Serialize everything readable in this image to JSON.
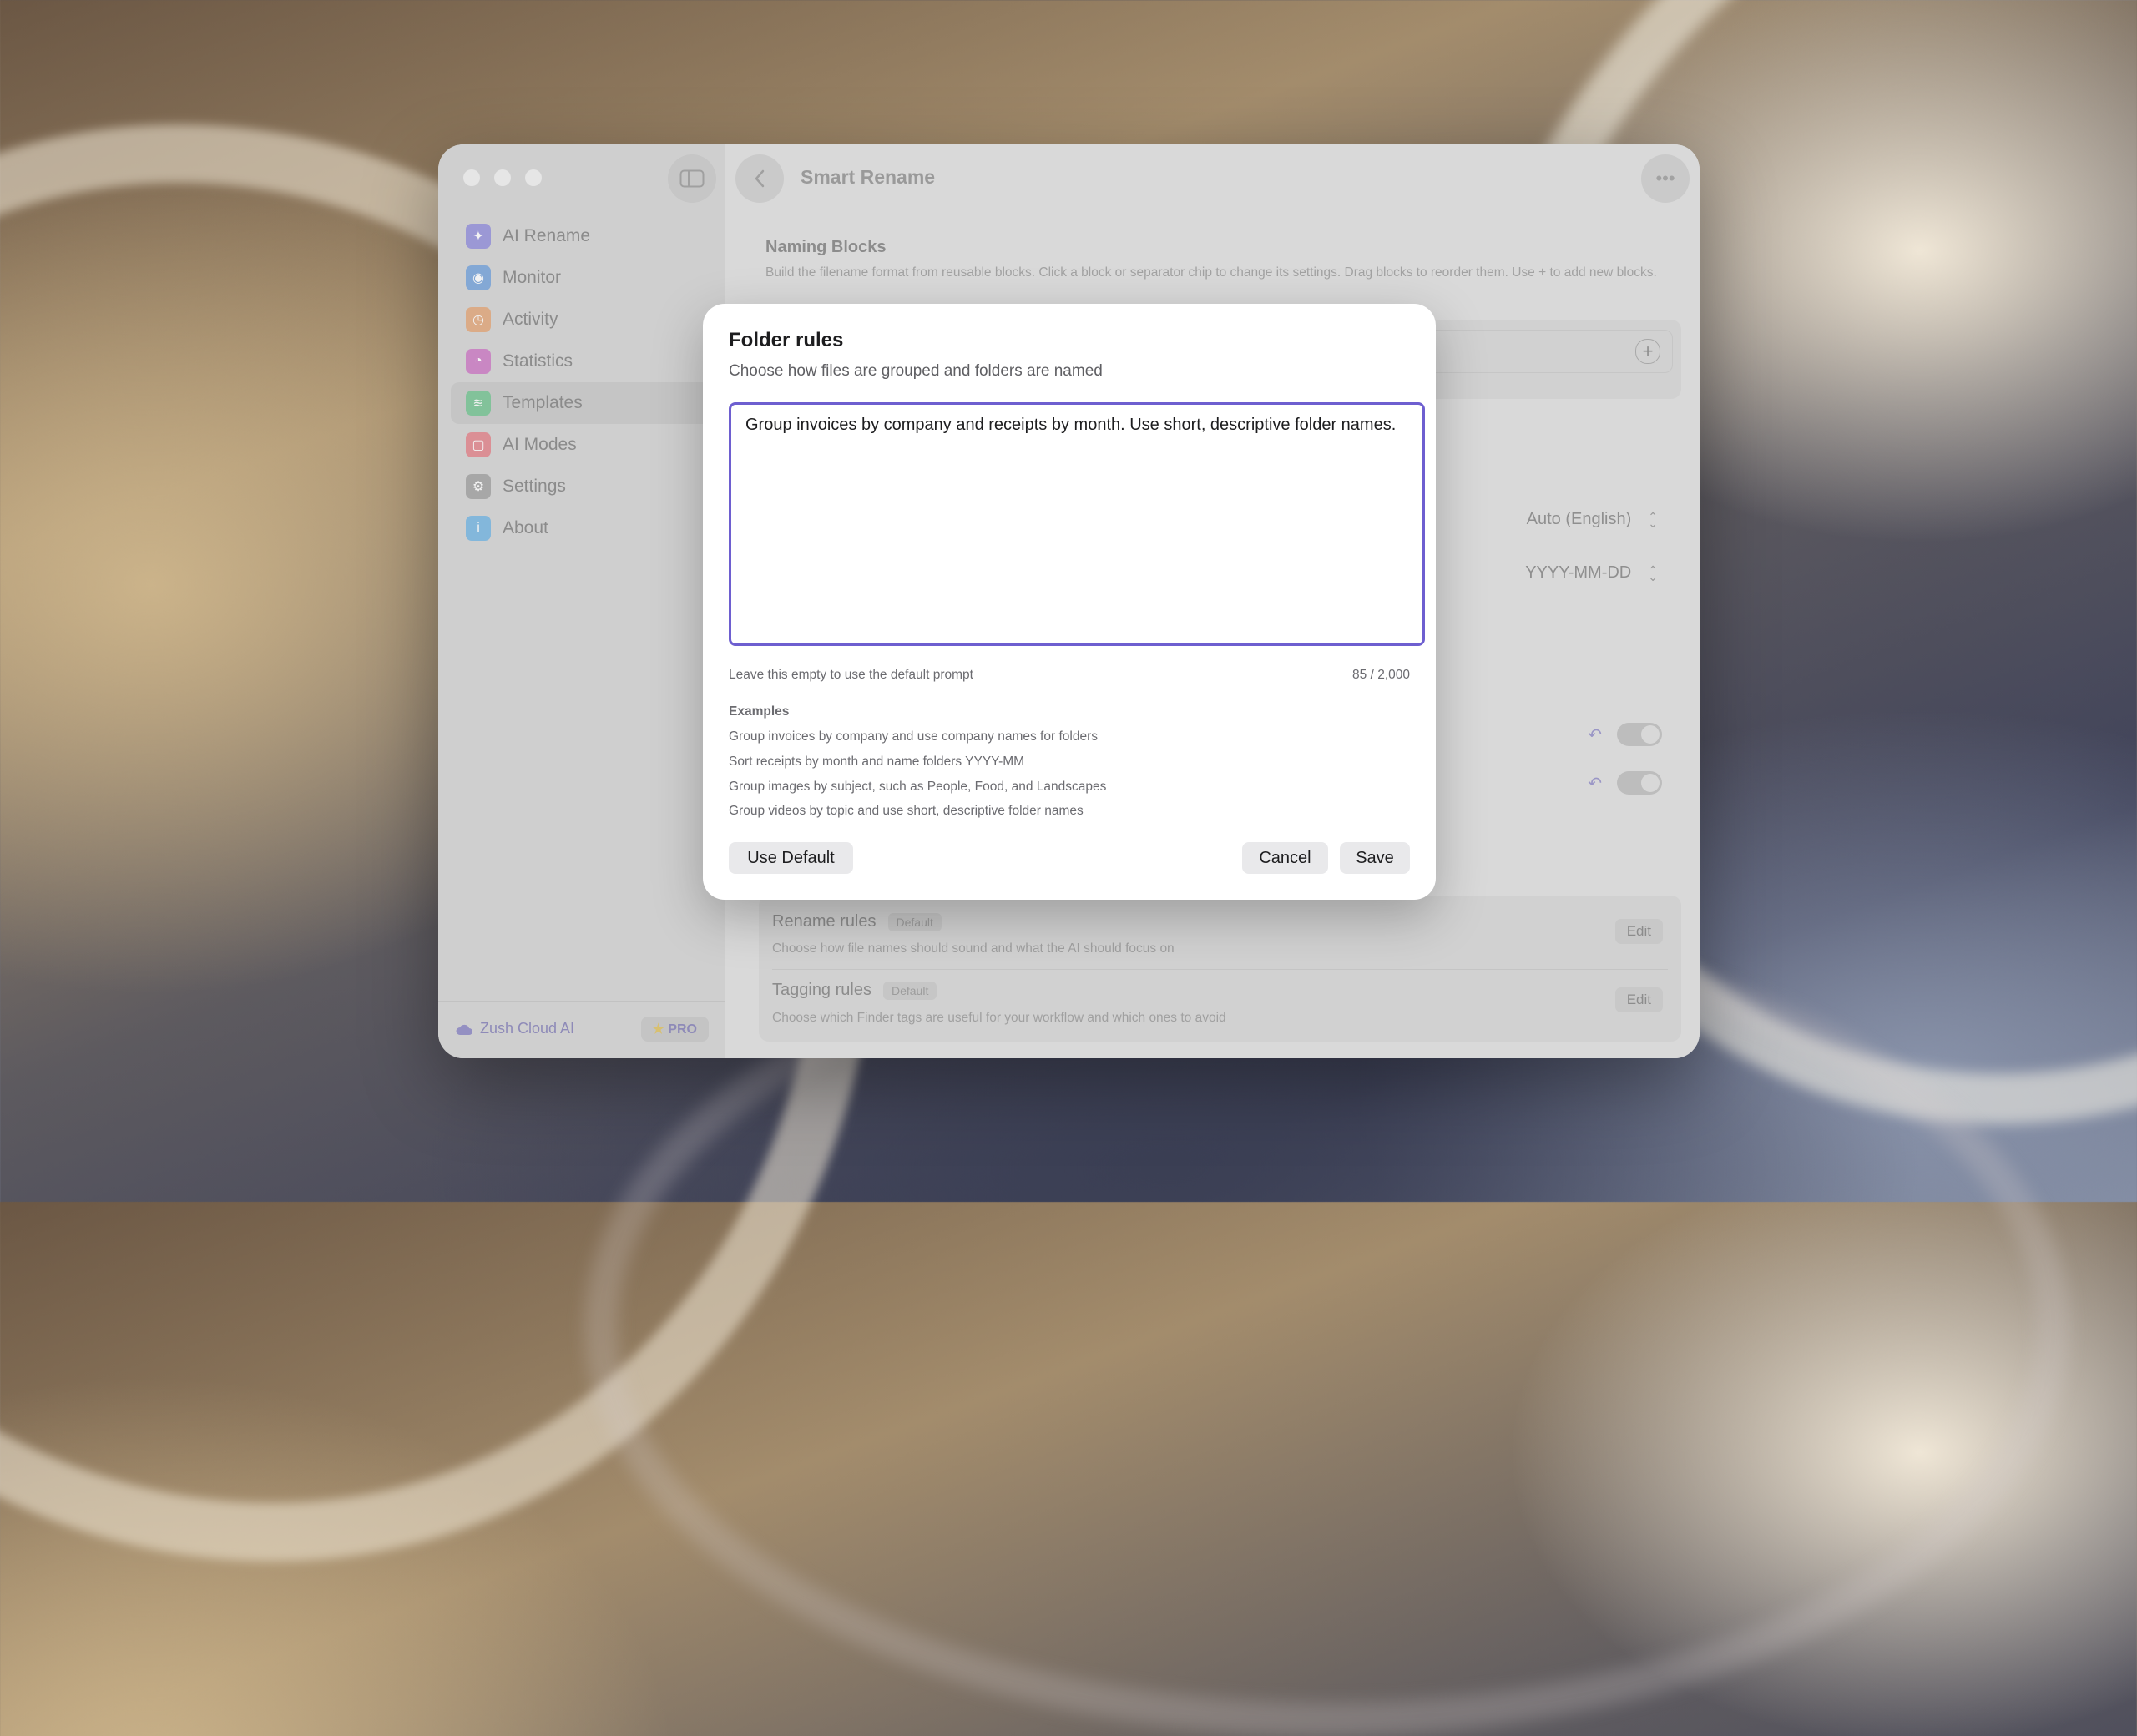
{
  "app": {
    "title": "Smart Rename",
    "sidebar": {
      "items": [
        {
          "label": "AI Rename",
          "icon": "sparkles-icon",
          "color": "#8a86d8"
        },
        {
          "label": "Monitor",
          "icon": "eye-icon",
          "color": "#6a9bd8"
        },
        {
          "label": "Activity",
          "icon": "clock-icon",
          "color": "#e0a070"
        },
        {
          "label": "Statistics",
          "icon": "pie-chart-icon",
          "color": "#c870c0"
        },
        {
          "label": "Templates",
          "icon": "layers-icon",
          "color": "#6cc28c"
        },
        {
          "label": "AI Modes",
          "icon": "square-icon",
          "color": "#e07a82"
        },
        {
          "label": "Settings",
          "icon": "gear-icon",
          "color": "#9a9a9a"
        },
        {
          "label": "About",
          "icon": "info-icon",
          "color": "#6ab0e0"
        }
      ],
      "active_index": 4,
      "footer": {
        "cloud_label": "Zush Cloud AI",
        "pro_label": "PRO"
      }
    },
    "main": {
      "naming_blocks": {
        "title": "Naming Blocks",
        "description": "Build the filename format from reusable blocks. Click a block or separator chip to change its settings. Drag blocks to reorder them. Use + to add new blocks."
      },
      "language_select": "Auto (English)",
      "date_select": "YYYY-MM-DD",
      "rules": [
        {
          "title": "Rename rules",
          "badge": "Default",
          "description": "Choose how file names should sound and what the AI should focus on",
          "edit_label": "Edit"
        },
        {
          "title": "Tagging rules",
          "badge": "Default",
          "description": "Choose which Finder tags are useful for your workflow and which ones to avoid",
          "edit_label": "Edit"
        }
      ]
    }
  },
  "dialog": {
    "title": "Folder rules",
    "subtitle": "Choose how files are grouped and folders are named",
    "text_value": "Group invoices by company and receipts by month. Use short, descriptive folder names.",
    "hint": "Leave this empty to use the default prompt",
    "counter": "85 / 2,000",
    "examples_title": "Examples",
    "examples": [
      "Group invoices by company and use company names for folders",
      "Sort receipts by month and name folders YYYY-MM",
      "Group images by subject, such as People, Food, and Landscapes",
      "Group videos by topic and use short, descriptive folder names"
    ],
    "buttons": {
      "use_default": "Use Default",
      "cancel": "Cancel",
      "save": "Save"
    },
    "accent_color": "#6e5fd0"
  }
}
